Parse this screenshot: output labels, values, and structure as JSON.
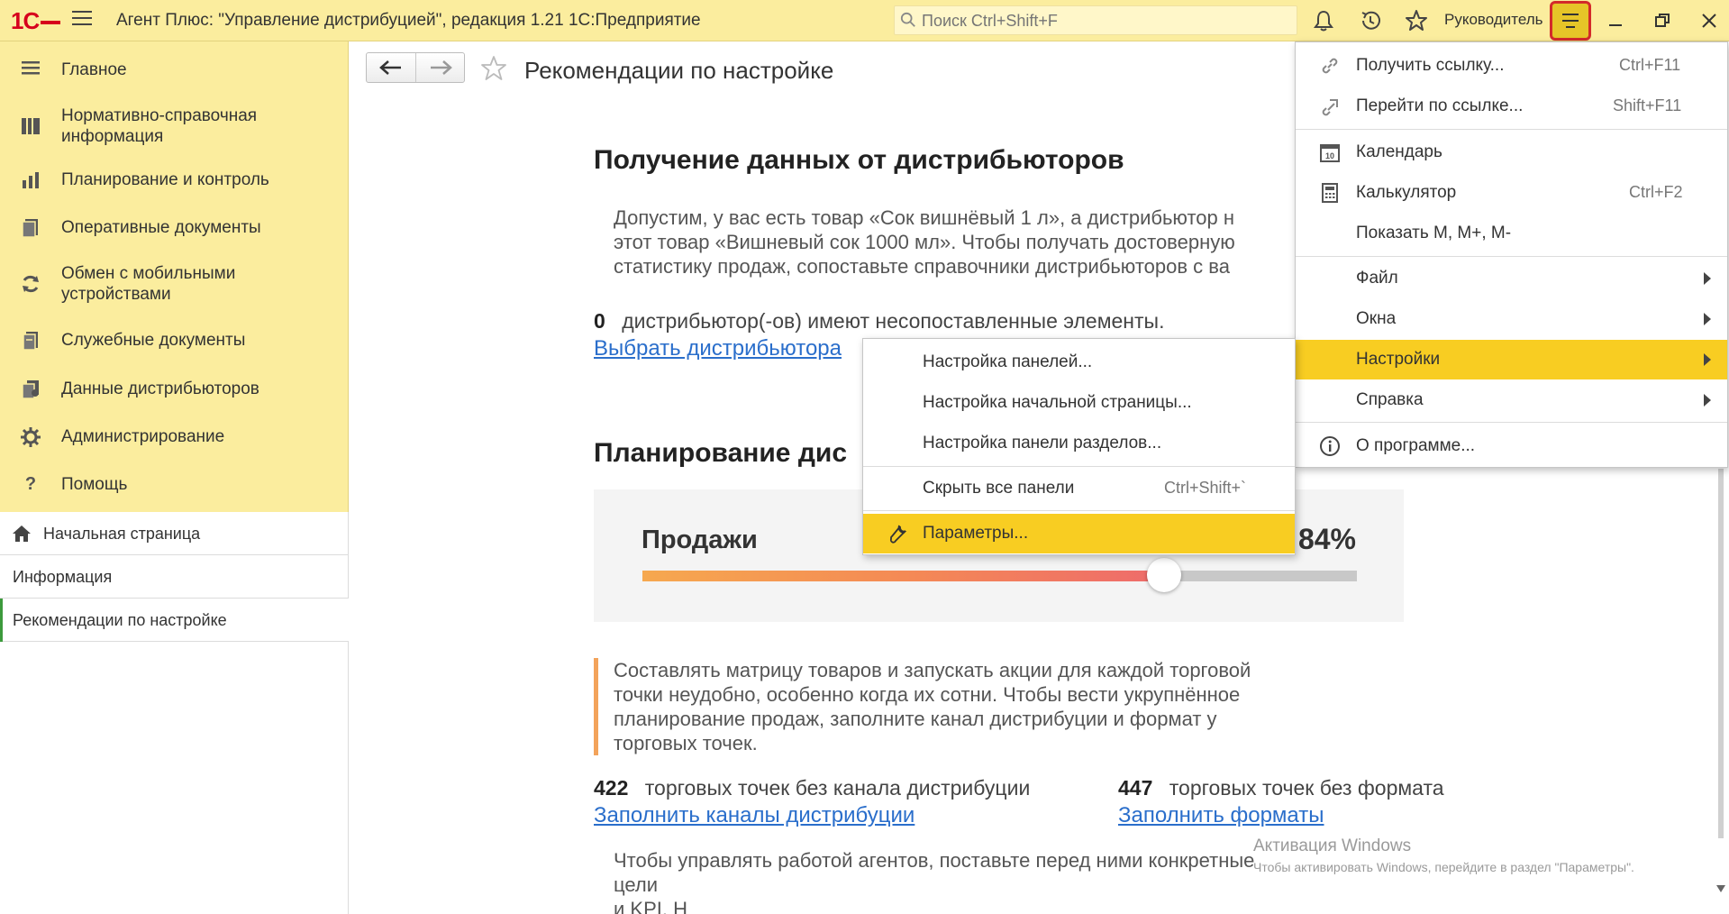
{
  "titlebar": {
    "title": "Агент Плюс: \"Управление дистрибуцией\", редакция 1.21 1С:Предприятие",
    "search_placeholder": "Поиск Ctrl+Shift+F",
    "user": "Руководитель"
  },
  "sidebar": {
    "sections": [
      {
        "label": "Главное",
        "icon": "menu-icon"
      },
      {
        "label": "Нормативно-справочная информация",
        "icon": "catalog-icon"
      },
      {
        "label": "Планирование и контроль",
        "icon": "chart-icon"
      },
      {
        "label": "Оперативные документы",
        "icon": "documents-icon"
      },
      {
        "label": "Обмен с мобильными устройствами",
        "icon": "sync-icon"
      },
      {
        "label": "Служебные документы",
        "icon": "service-docs-icon"
      },
      {
        "label": "Данные дистрибьюторов",
        "icon": "distributor-data-icon"
      },
      {
        "label": "Администрирование",
        "icon": "gear-icon"
      },
      {
        "label": "Помощь",
        "icon": "help-icon"
      }
    ],
    "opened": [
      {
        "label": "Начальная страница",
        "icon": "home-icon"
      },
      {
        "label": "Информация"
      },
      {
        "label": "Рекомендации по настройке"
      }
    ]
  },
  "page": {
    "title": "Рекомендации по настройке",
    "section1": {
      "heading": "Получение данных от дистрибьюторов",
      "text_lines": [
        "Допустим, у вас есть товар «Сок вишнёвый 1 л», а дистрибьютор н",
        "этот товар «Вишневый сок 1000 мл». Чтобы получать достоверную",
        "статистику продаж, сопоставьте справочники дистрибьюторов с ва"
      ],
      "stat_count": "0",
      "stat_text": "дистрибьютор(-ов) имеют несопоставленные элементы.",
      "link": "Выбрать дистрибьютора"
    },
    "section2": {
      "heading": "Планирование дис",
      "sales_label": "Продажи",
      "sales_pct": "84%",
      "sales_fraction": 0.73,
      "text_lines": [
        "Составлять матрицу товаров и запускать акции для каждой торговой",
        "точки неудобно, особенно когда их сотни. Чтобы вести укрупнённое",
        "планирование продаж, заполните канал дистрибуции и формат у",
        "торговых точек."
      ],
      "stat1_count": "422",
      "stat1_text": "торговых точек без канала дистрибуции",
      "link1": "Заполнить каналы дистрибуции",
      "stat2_count": "447",
      "stat2_text": "торговых точек без формата",
      "link2": "Заполнить форматы"
    },
    "section3": {
      "text_lines": [
        "Чтобы управлять работой агентов, поставьте перед ними конкретные",
        "цели",
        "и KPI. Н"
      ]
    }
  },
  "main_menu": {
    "items": [
      {
        "label": "Получить ссылку...",
        "shortcut": "Ctrl+F11",
        "icon": "link-icon"
      },
      {
        "label": "Перейти по ссылке...",
        "shortcut": "Shift+F11",
        "icon": "follow-link-icon"
      },
      {
        "label": "Календарь",
        "shortcut": "",
        "icon": "calendar-icon"
      },
      {
        "label": "Калькулятор",
        "shortcut": "Ctrl+F2",
        "icon": "calculator-icon"
      },
      {
        "label": "Показать M, M+, M-",
        "shortcut": ""
      },
      {
        "label": "Файл",
        "submenu": true
      },
      {
        "label": "Окна",
        "submenu": true
      },
      {
        "label": "Настройки",
        "submenu": true,
        "highlighted": true
      },
      {
        "label": "Справка",
        "submenu": true
      },
      {
        "label": "О программе...",
        "icon": "info-icon"
      }
    ]
  },
  "settings_submenu": {
    "items": [
      {
        "label": "Настройка панелей..."
      },
      {
        "label": "Настройка начальной страницы..."
      },
      {
        "label": "Настройка панели разделов..."
      },
      {
        "label": "Скрыть все панели",
        "shortcut": "Ctrl+Shift+`"
      },
      {
        "label": "Параметры...",
        "icon": "wrench-icon",
        "highlighted": true
      }
    ]
  },
  "watermark": {
    "line1": "Активация Windows",
    "line2": "Чтобы активировать Windows, перейдите в раздел \"Параметры\"."
  },
  "colors": {
    "panel_yellow": "#fbed9e",
    "highlight_yellow": "#f8cd22",
    "link_blue": "#2a6ecb",
    "accent_red": "#e24a4a",
    "accent_orange": "#f3a35b"
  }
}
